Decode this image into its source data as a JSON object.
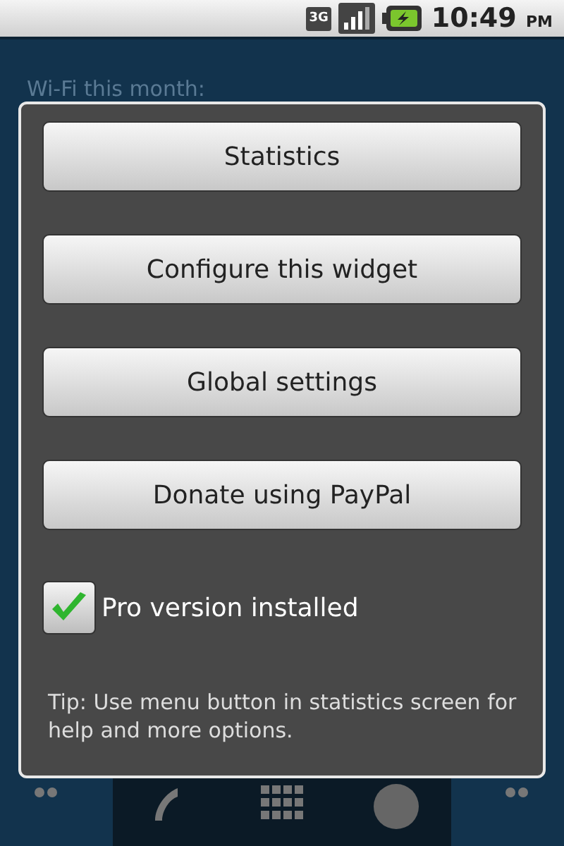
{
  "status_bar": {
    "network": "3G",
    "time": "10:49",
    "ampm": "PM"
  },
  "background": {
    "label": "Wi-Fi this month:"
  },
  "dialog": {
    "buttons": [
      "Statistics",
      "Configure this widget",
      "Global settings",
      "Donate using PayPal"
    ],
    "checkbox": {
      "label": "Pro version installed",
      "checked": true
    },
    "tip": "Tip: Use menu button in statistics screen for help and more options."
  }
}
